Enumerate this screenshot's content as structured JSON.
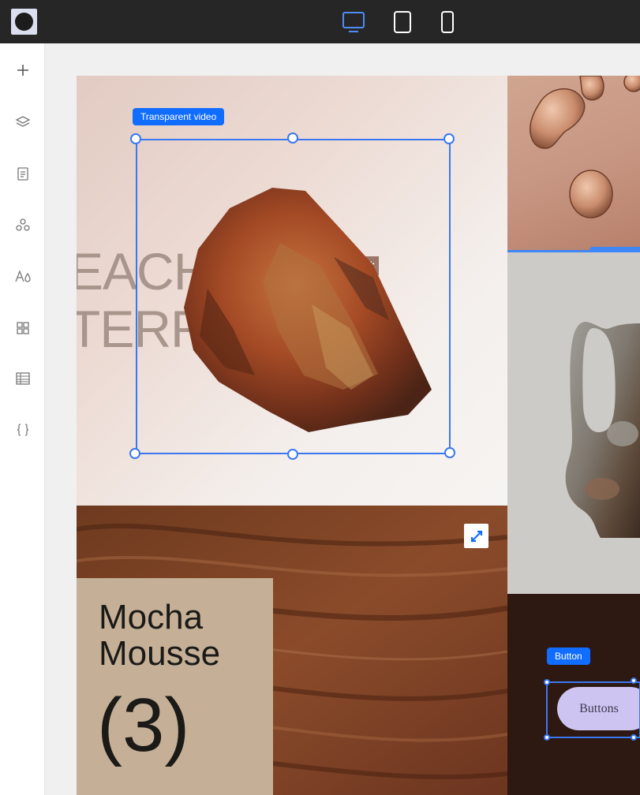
{
  "toolbar": {
    "devices": [
      {
        "name": "desktop",
        "active": true
      },
      {
        "name": "tablet",
        "active": false
      },
      {
        "name": "mobile",
        "active": false
      }
    ]
  },
  "sidebar": {
    "items": [
      "add-icon",
      "layers-icon",
      "pages-icon",
      "components-icon",
      "typography-icon",
      "apps-icon",
      "table-icon",
      "code-icon"
    ]
  },
  "canvas": {
    "hero": {
      "line1": "EACH HEIG",
      "line2": "TERR 5.25",
      "badge": "✲"
    },
    "selection_video": {
      "label": "Transparent video"
    },
    "mocha": {
      "title_line1": "Mocha",
      "title_line2": "Mousse",
      "number": "(3)"
    },
    "selection_button": {
      "label": "Button"
    },
    "button": {
      "text": "Buttons"
    }
  },
  "colors": {
    "accent": "#116dff",
    "selection": "#3b78f0",
    "topbar": "#262626",
    "mocha_panel": "#c5b097",
    "button_fill": "#cdc4f2"
  }
}
